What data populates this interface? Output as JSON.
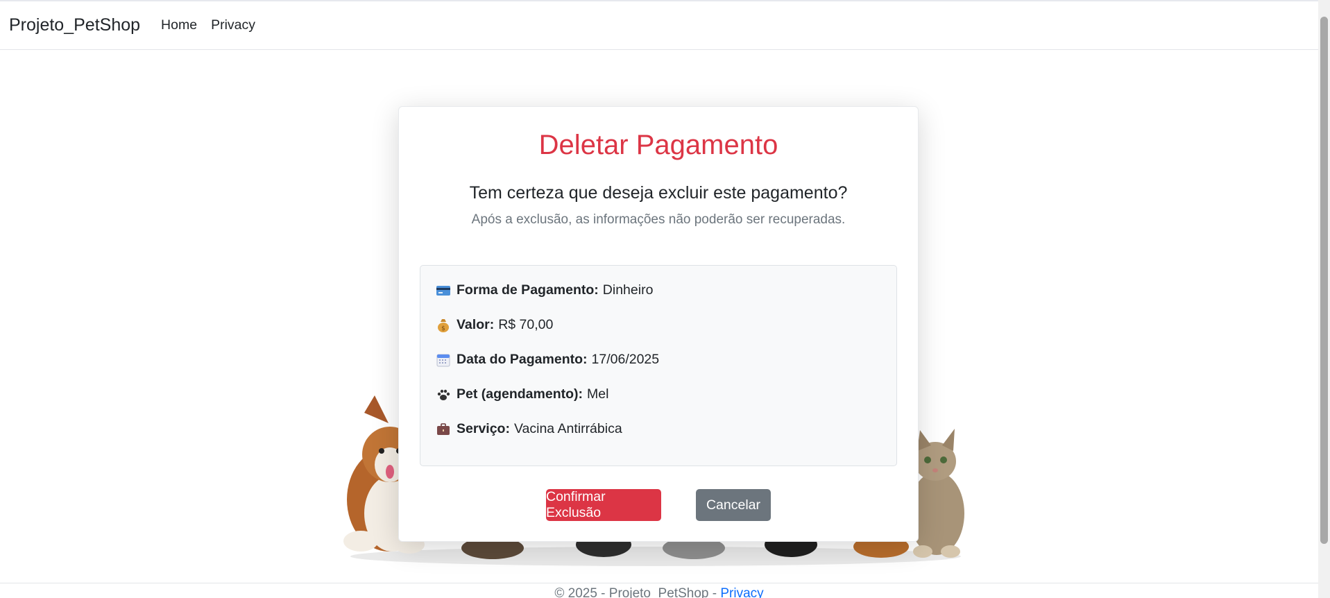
{
  "navbar": {
    "brand": "Projeto_PetShop",
    "links": [
      "Home",
      "Privacy"
    ]
  },
  "card": {
    "title": "Deletar Pagamento",
    "question": "Tem certeza que deseja excluir este pagamento?",
    "warning": "Após a exclusão, as informações não poderão ser recuperadas.",
    "details": [
      {
        "icon": "credit-card-icon",
        "label": "Forma de Pagamento:",
        "value": "Dinheiro"
      },
      {
        "icon": "money-bag-icon",
        "label": "Valor:",
        "value": "R$ 70,00"
      },
      {
        "icon": "calendar-icon",
        "label": "Data do Pagamento:",
        "value": "17/06/2025"
      },
      {
        "icon": "paw-icon",
        "label": "Pet (agendamento):",
        "value": "Mel"
      },
      {
        "icon": "briefcase-icon",
        "label": "Serviço:",
        "value": "Vacina Antirrábica"
      }
    ],
    "confirm_label": "Confirmar Exclusão",
    "cancel_label": "Cancelar"
  },
  "footer": {
    "text": "© 2025 - Projeto_PetShop - ",
    "link": "Privacy"
  },
  "colors": {
    "danger": "#dc3545",
    "secondary": "#6c757d",
    "link": "#0d6efd"
  }
}
